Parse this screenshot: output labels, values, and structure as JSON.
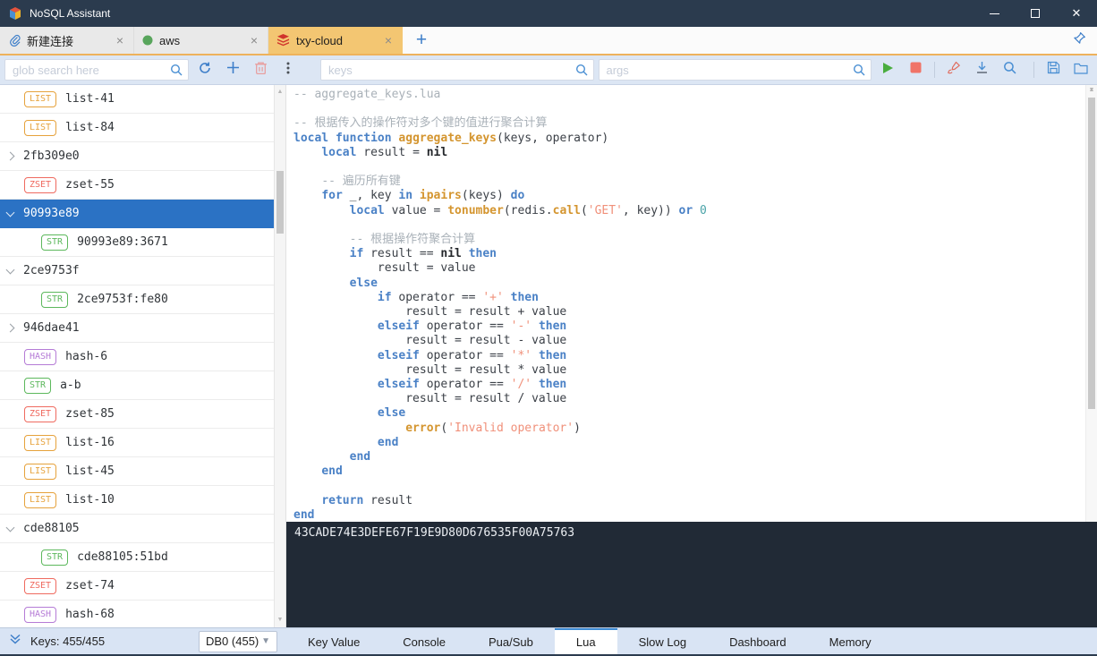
{
  "titlebar": {
    "title": "NoSQL Assistant"
  },
  "connection_tabs": [
    {
      "label": "新建连接",
      "icon": "paperclip-icon",
      "active": false
    },
    {
      "label": "aws",
      "icon": "green-db-icon",
      "active": false
    },
    {
      "label": "txy-cloud",
      "icon": "redis-icon",
      "active": true
    }
  ],
  "toolbar": {
    "glob_placeholder": "glob search here",
    "keys_placeholder": "keys",
    "args_placeholder": "args"
  },
  "sidebar": {
    "items": [
      {
        "kind": "key",
        "badge": "LIST",
        "label": "list-41",
        "indent": 1
      },
      {
        "kind": "key",
        "badge": "LIST",
        "label": "list-84",
        "indent": 1
      },
      {
        "kind": "folder",
        "state": "collapsed",
        "label": "2fb309e0",
        "indent": 0
      },
      {
        "kind": "key",
        "badge": "ZSET",
        "label": "zset-55",
        "indent": 1
      },
      {
        "kind": "folder",
        "state": "expanded",
        "label": "90993e89",
        "indent": 0,
        "selected": true
      },
      {
        "kind": "key",
        "badge": "STR",
        "label": "90993e89:3671",
        "indent": 2
      },
      {
        "kind": "folder",
        "state": "expanded",
        "label": "2ce9753f",
        "indent": 0
      },
      {
        "kind": "key",
        "badge": "STR",
        "label": "2ce9753f:fe80",
        "indent": 2
      },
      {
        "kind": "folder",
        "state": "collapsed",
        "label": "946dae41",
        "indent": 0
      },
      {
        "kind": "key",
        "badge": "HASH",
        "label": "hash-6",
        "indent": 1
      },
      {
        "kind": "key",
        "badge": "STR",
        "label": "a-b",
        "indent": 1
      },
      {
        "kind": "key",
        "badge": "ZSET",
        "label": "zset-85",
        "indent": 1
      },
      {
        "kind": "key",
        "badge": "LIST",
        "label": "list-16",
        "indent": 1
      },
      {
        "kind": "key",
        "badge": "LIST",
        "label": "list-45",
        "indent": 1
      },
      {
        "kind": "key",
        "badge": "LIST",
        "label": "list-10",
        "indent": 1
      },
      {
        "kind": "folder",
        "state": "expanded",
        "label": "cde88105",
        "indent": 0
      },
      {
        "kind": "key",
        "badge": "STR",
        "label": "cde88105:51bd",
        "indent": 2
      },
      {
        "kind": "key",
        "badge": "ZSET",
        "label": "zset-74",
        "indent": 1
      },
      {
        "kind": "key",
        "badge": "HASH",
        "label": "hash-68",
        "indent": 1
      }
    ]
  },
  "editor": {
    "lines": [
      [
        [
          "c",
          "-- aggregate_keys.lua"
        ]
      ],
      [],
      [
        [
          "c",
          "-- 根据传入的操作符对多个键的值进行聚合计算"
        ]
      ],
      [
        [
          "k",
          "local"
        ],
        [
          "p",
          " "
        ],
        [
          "k",
          "function"
        ],
        [
          "p",
          " "
        ],
        [
          "f",
          "aggregate_keys"
        ],
        [
          "p",
          "(keys, operator)"
        ]
      ],
      [
        [
          "p",
          "    "
        ],
        [
          "k",
          "local"
        ],
        [
          "p",
          " result = "
        ],
        [
          "b",
          "nil"
        ]
      ],
      [],
      [
        [
          "p",
          "    "
        ],
        [
          "c",
          "-- 遍历所有键"
        ]
      ],
      [
        [
          "p",
          "    "
        ],
        [
          "k",
          "for"
        ],
        [
          "p",
          " _, key "
        ],
        [
          "k",
          "in"
        ],
        [
          "p",
          " "
        ],
        [
          "f",
          "ipairs"
        ],
        [
          "p",
          "(keys) "
        ],
        [
          "k",
          "do"
        ]
      ],
      [
        [
          "p",
          "        "
        ],
        [
          "k",
          "local"
        ],
        [
          "p",
          " value = "
        ],
        [
          "f",
          "tonumber"
        ],
        [
          "p",
          "(redis."
        ],
        [
          "f",
          "call"
        ],
        [
          "p",
          "("
        ],
        [
          "s",
          "'GET'"
        ],
        [
          "p",
          ", key)) "
        ],
        [
          "k",
          "or"
        ],
        [
          "p",
          " "
        ],
        [
          "n",
          "0"
        ]
      ],
      [],
      [
        [
          "p",
          "        "
        ],
        [
          "c",
          "-- 根据操作符聚合计算"
        ]
      ],
      [
        [
          "p",
          "        "
        ],
        [
          "k",
          "if"
        ],
        [
          "p",
          " result == "
        ],
        [
          "b",
          "nil"
        ],
        [
          "p",
          " "
        ],
        [
          "k",
          "then"
        ]
      ],
      [
        [
          "p",
          "            result = value"
        ]
      ],
      [
        [
          "p",
          "        "
        ],
        [
          "k",
          "else"
        ]
      ],
      [
        [
          "p",
          "            "
        ],
        [
          "k",
          "if"
        ],
        [
          "p",
          " operator == "
        ],
        [
          "s",
          "'+'"
        ],
        [
          "p",
          " "
        ],
        [
          "k",
          "then"
        ]
      ],
      [
        [
          "p",
          "                result = result + value"
        ]
      ],
      [
        [
          "p",
          "            "
        ],
        [
          "k",
          "elseif"
        ],
        [
          "p",
          " operator == "
        ],
        [
          "s",
          "'-'"
        ],
        [
          "p",
          " "
        ],
        [
          "k",
          "then"
        ]
      ],
      [
        [
          "p",
          "                result = result - value"
        ]
      ],
      [
        [
          "p",
          "            "
        ],
        [
          "k",
          "elseif"
        ],
        [
          "p",
          " operator == "
        ],
        [
          "s",
          "'*'"
        ],
        [
          "p",
          " "
        ],
        [
          "k",
          "then"
        ]
      ],
      [
        [
          "p",
          "                result = result * value"
        ]
      ],
      [
        [
          "p",
          "            "
        ],
        [
          "k",
          "elseif"
        ],
        [
          "p",
          " operator == "
        ],
        [
          "s",
          "'/'"
        ],
        [
          "p",
          " "
        ],
        [
          "k",
          "then"
        ]
      ],
      [
        [
          "p",
          "                result = result / value"
        ]
      ],
      [
        [
          "p",
          "            "
        ],
        [
          "k",
          "else"
        ]
      ],
      [
        [
          "p",
          "                "
        ],
        [
          "f",
          "error"
        ],
        [
          "p",
          "("
        ],
        [
          "s",
          "'Invalid operator'"
        ],
        [
          "p",
          ")"
        ]
      ],
      [
        [
          "p",
          "            "
        ],
        [
          "k",
          "end"
        ]
      ],
      [
        [
          "p",
          "        "
        ],
        [
          "k",
          "end"
        ]
      ],
      [
        [
          "p",
          "    "
        ],
        [
          "k",
          "end"
        ]
      ],
      [],
      [
        [
          "p",
          "    "
        ],
        [
          "k",
          "return"
        ],
        [
          "p",
          " result"
        ]
      ],
      [
        [
          "k",
          "end"
        ]
      ]
    ]
  },
  "console": {
    "output": "43CADE74E3DEFE67F19E9D80D676535F00A75763"
  },
  "statusbar": {
    "keys_count": "Keys: 455/455",
    "db_select": "DB0 (455)"
  },
  "bottom_tabs": [
    {
      "label": "Key Value",
      "active": false
    },
    {
      "label": "Console",
      "active": false
    },
    {
      "label": "Pua/Sub",
      "active": false
    },
    {
      "label": "Lua",
      "active": true
    },
    {
      "label": "Slow Log",
      "active": false
    },
    {
      "label": "Dashboard",
      "active": false
    },
    {
      "label": "Memory",
      "active": false
    }
  ],
  "colors": {
    "accent": "#2b72c4",
    "titlebar": "#2b3b4e",
    "tab_active": "#f3c672",
    "tab_strip_underline": "#eeb25c",
    "selected_row": "#2b72c4",
    "console_bg": "#212a36",
    "play": "#49ad3e",
    "stop": "#f07468",
    "badges": {
      "LIST": "#e6a23c",
      "ZSET": "#ef6a5f",
      "STR": "#5cb85c",
      "HASH": "#b57bd6"
    }
  }
}
